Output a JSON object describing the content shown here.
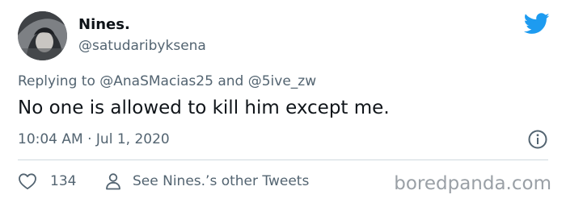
{
  "tweet": {
    "author": {
      "display_name": "Nines.",
      "handle": "@satudaribyksena",
      "avatar": "avatar-image"
    },
    "reply": {
      "prefix": "Replying to",
      "mention_1": "@AnaSMacias25",
      "joiner": "and",
      "mention_2": "@5ive_zw"
    },
    "text": "No one is allowed to kill him except me.",
    "timestamp": "10:04 AM · Jul 1, 2020",
    "likes": "134",
    "profile_link": "See Nines.’s other Tweets",
    "icons": {
      "brand": "twitter-bird-icon",
      "info": "info-icon",
      "like": "heart-icon",
      "profile": "person-icon"
    },
    "colors": {
      "brand": "#1d9bf0",
      "text": "#0f1419",
      "muted": "#536471",
      "divider": "#cfd9de"
    }
  },
  "watermark": "boredpanda.com"
}
